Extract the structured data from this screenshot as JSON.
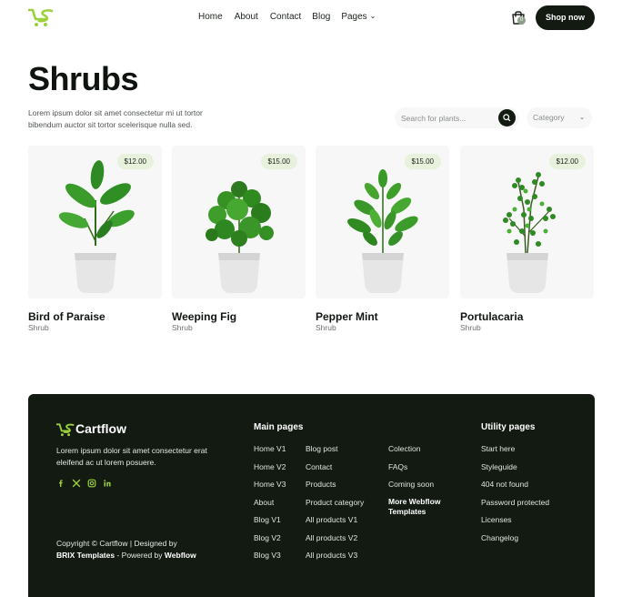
{
  "header": {
    "logo_icon": "cartflow-logo-icon",
    "nav": [
      {
        "label": "Home"
      },
      {
        "label": "About"
      },
      {
        "label": "Contact"
      },
      {
        "label": "Blog"
      },
      {
        "label": "Pages"
      }
    ],
    "cart_icon": "shopping-bag-icon",
    "cart_count": "0",
    "shop_button": "Shop now"
  },
  "hero": {
    "title": "Shrubs",
    "description": "Lorem ipsum dolor sit amet consectetur mi ut tortor bibendum auctor sit tortor scelerisque nulla sed.",
    "search_placeholder": "Search for plants...",
    "category_label": "Category"
  },
  "products": [
    {
      "price": "$12.00",
      "name": "Bird of Paraise",
      "category": "Shrub"
    },
    {
      "price": "$15.00",
      "name": "Weeping Fig",
      "category": "Shrub"
    },
    {
      "price": "$15.00",
      "name": "Pepper Mint",
      "category": "Shrub"
    },
    {
      "price": "$12.00",
      "name": "Portulacaria",
      "category": "Shrub"
    }
  ],
  "footer": {
    "brand": "Cartflow",
    "description": "Lorem ipsum dolor sit amet consectetur erat eleifend ac ut lorem posuere.",
    "social_icons": [
      "facebook-icon",
      "x-icon",
      "instagram-icon",
      "linkedin-icon"
    ],
    "copyright_prefix": "Copyright © Cartflow | Designed by",
    "copyright_brix": "BRIX Templates",
    "copyright_mid": " - Powered by ",
    "copyright_webflow": "Webflow",
    "main_pages_heading": "Main pages",
    "main_col1": [
      "Home V1",
      "Home V2",
      "Home V3",
      "About",
      "Blog V1",
      "Blog V2",
      "Blog V3"
    ],
    "main_col2": [
      "Blog post",
      "Contact",
      "Products",
      "Product category",
      "All products V1",
      "All products V2",
      "All products V3"
    ],
    "main_col3": [
      "Colection",
      "FAQs",
      "Coming soon"
    ],
    "more_templates": "More Webflow Templates",
    "utility_heading": "Utility pages",
    "utility_links": [
      "Start here",
      "Styleguide",
      "404 not found",
      "Password protected",
      "Licenses",
      "Changelog"
    ]
  },
  "colors": {
    "accent": "#9bd13a",
    "dark": "#121a12",
    "card_bg": "#f6f7f6",
    "price_bg": "#e8f1dc"
  }
}
